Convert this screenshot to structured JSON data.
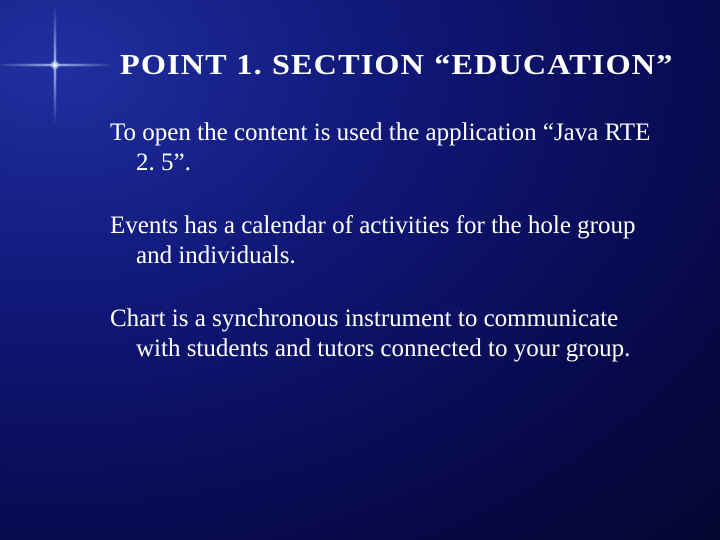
{
  "title": "Point 1. Section  “Education”",
  "paragraphs": [
    "To open the content is used the application “Java RTE 2. 5”.",
    "Events has a calendar of activities for the hole group and individuals.",
    "Chart is a synchronous instrument to communicate with students and tutors connected to your group."
  ]
}
